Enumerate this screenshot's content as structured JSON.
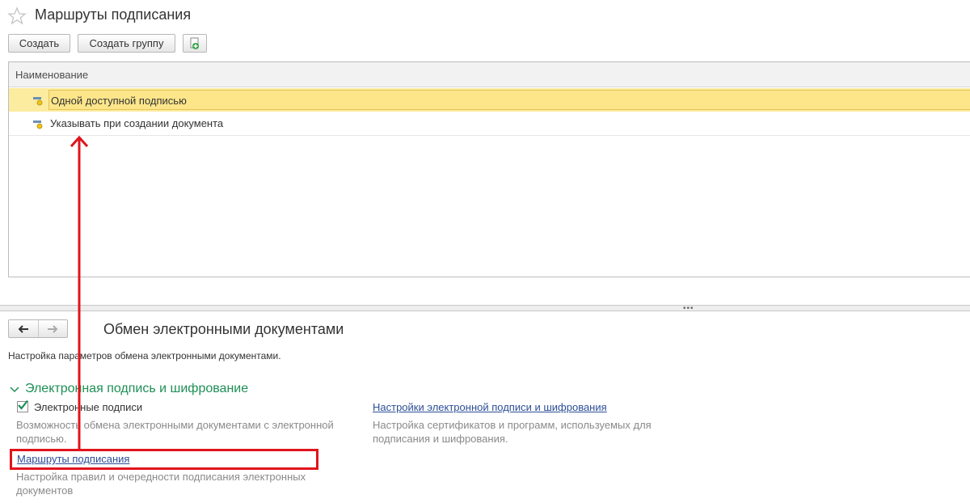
{
  "header": {
    "title": "Маршруты подписания",
    "buttons": {
      "create": "Создать",
      "create_group": "Создать группу"
    }
  },
  "list": {
    "column_header": "Наименование",
    "rows": [
      {
        "name": "Одной доступной подписью",
        "selected": true
      },
      {
        "name": "Указывать при создании документа",
        "selected": false
      }
    ]
  },
  "lower_panel": {
    "title": "Обмен электронными документами",
    "description": "Настройка параметров обмена электронными документами.",
    "group_title": "Электронная подпись и шифрование",
    "checkbox_label": "Электронные подписи",
    "checkbox_checked": true,
    "checkbox_description": "Возможность обмена электронными документами с электронной подписью.",
    "link_settings": "Настройки электронной подписи и шифрования",
    "link_settings_description": "Настройка сертификатов и программ, используемых для подписания и шифрования.",
    "link_routes": "Маршруты подписания",
    "link_routes_description": "Настройка правил и очередности подписания электронных документов"
  },
  "colors": {
    "selected_row": "#fde68a",
    "group_title": "#1e8f55",
    "link": "#2d4e96",
    "annotation": "#e0141c"
  },
  "icons": {
    "favorite": "star-icon",
    "row": "catalog-item-icon",
    "add_copy": "add-document-icon",
    "back": "arrow-left-icon",
    "forward": "arrow-right-icon"
  }
}
